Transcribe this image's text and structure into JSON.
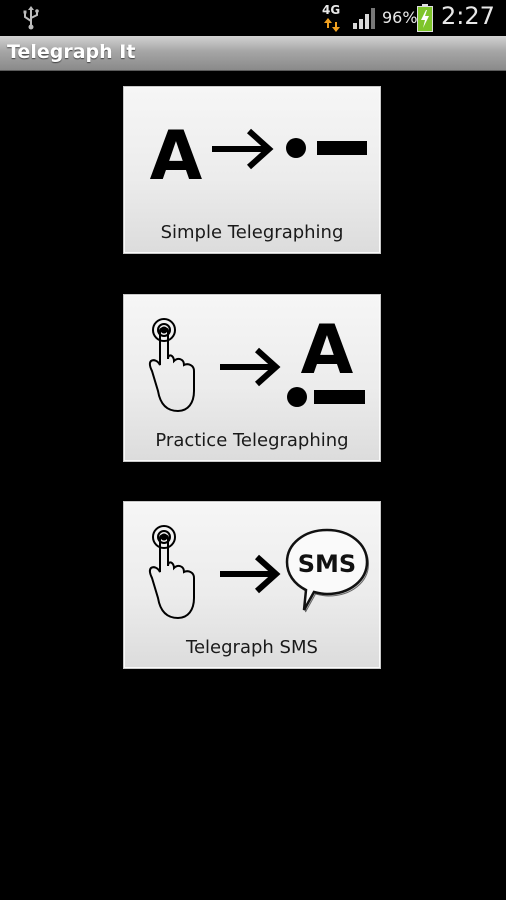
{
  "status_bar": {
    "network": "4G",
    "battery_percent": "96%",
    "time": "2:27",
    "icons": [
      "usb-icon",
      "network-arrows-icon",
      "signal-icon",
      "battery-charging-icon"
    ]
  },
  "app": {
    "title": "Telegraph It"
  },
  "menu": [
    {
      "label": "Simple Telegraphing",
      "graphic_letter": "A"
    },
    {
      "label": "Practice Telegraphing",
      "graphic_letter": "A"
    },
    {
      "label": "Telegraph SMS",
      "graphic_text": "SMS"
    }
  ],
  "colors": {
    "background": "#000000",
    "title_bar_top": "#d2d2d2",
    "title_bar_bottom": "#8a8a8a",
    "button_face": "#ececec",
    "battery_charge": "#7ec52a"
  }
}
